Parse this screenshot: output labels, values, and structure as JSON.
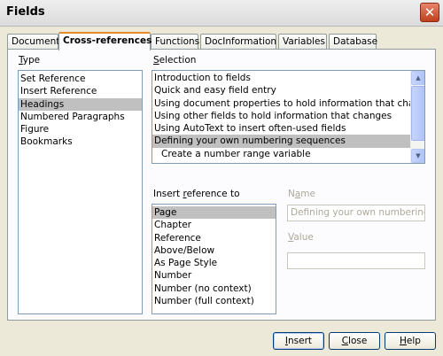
{
  "window": {
    "title": "Fields",
    "close_glyph": "✕"
  },
  "tabs": [
    "Document",
    "Cross-references",
    "Functions",
    "DocInformation",
    "Variables",
    "Database"
  ],
  "active_tab": "Cross-references",
  "type_section": {
    "label_prefix": "",
    "label_accel": "T",
    "label_rest": "ype",
    "items": [
      "Set Reference",
      "Insert Reference",
      "Headings",
      "Numbered Paragraphs",
      "Figure",
      "Bookmarks"
    ],
    "selected": "Headings"
  },
  "selection_section": {
    "label_prefix": "",
    "label_accel": "S",
    "label_rest": "election",
    "items": [
      "Introduction to fields",
      "Quick and easy field entry",
      "Using document properties to hold information that changes",
      "Using other fields to hold information that changes",
      "Using AutoText to insert often-used fields",
      "Defining your own numbering sequences",
      "  Create a number range variable"
    ],
    "selected": "Defining your own numbering sequences",
    "scroll_up_glyph": "▲",
    "scroll_down_glyph": "▼"
  },
  "insert_reference_section": {
    "label_prefix": "Insert ",
    "label_accel": "r",
    "label_rest": "eference to",
    "items": [
      "Page",
      "Chapter",
      "Reference",
      "Above/Below",
      "As Page Style",
      "Number",
      "Number (no context)",
      "Number (full context)"
    ],
    "selected": "Page"
  },
  "name_field": {
    "label_prefix": "N",
    "label_accel": "a",
    "label_rest": "me",
    "value": "Defining your own numbering s"
  },
  "value_field": {
    "label_prefix": "",
    "label_accel": "V",
    "label_rest": "alue",
    "value": ""
  },
  "buttons": {
    "insert": {
      "accel": "I",
      "rest": "nsert"
    },
    "close": {
      "accel": "C",
      "rest": "lose"
    },
    "help": {
      "accel": "H",
      "rest": "elp"
    }
  },
  "colors": {
    "dialog_bg": "#ece9d8",
    "selected_bg": "#c0c0c0",
    "active_tab_accent": "#e68b2c",
    "close_button": "#c0401c"
  }
}
